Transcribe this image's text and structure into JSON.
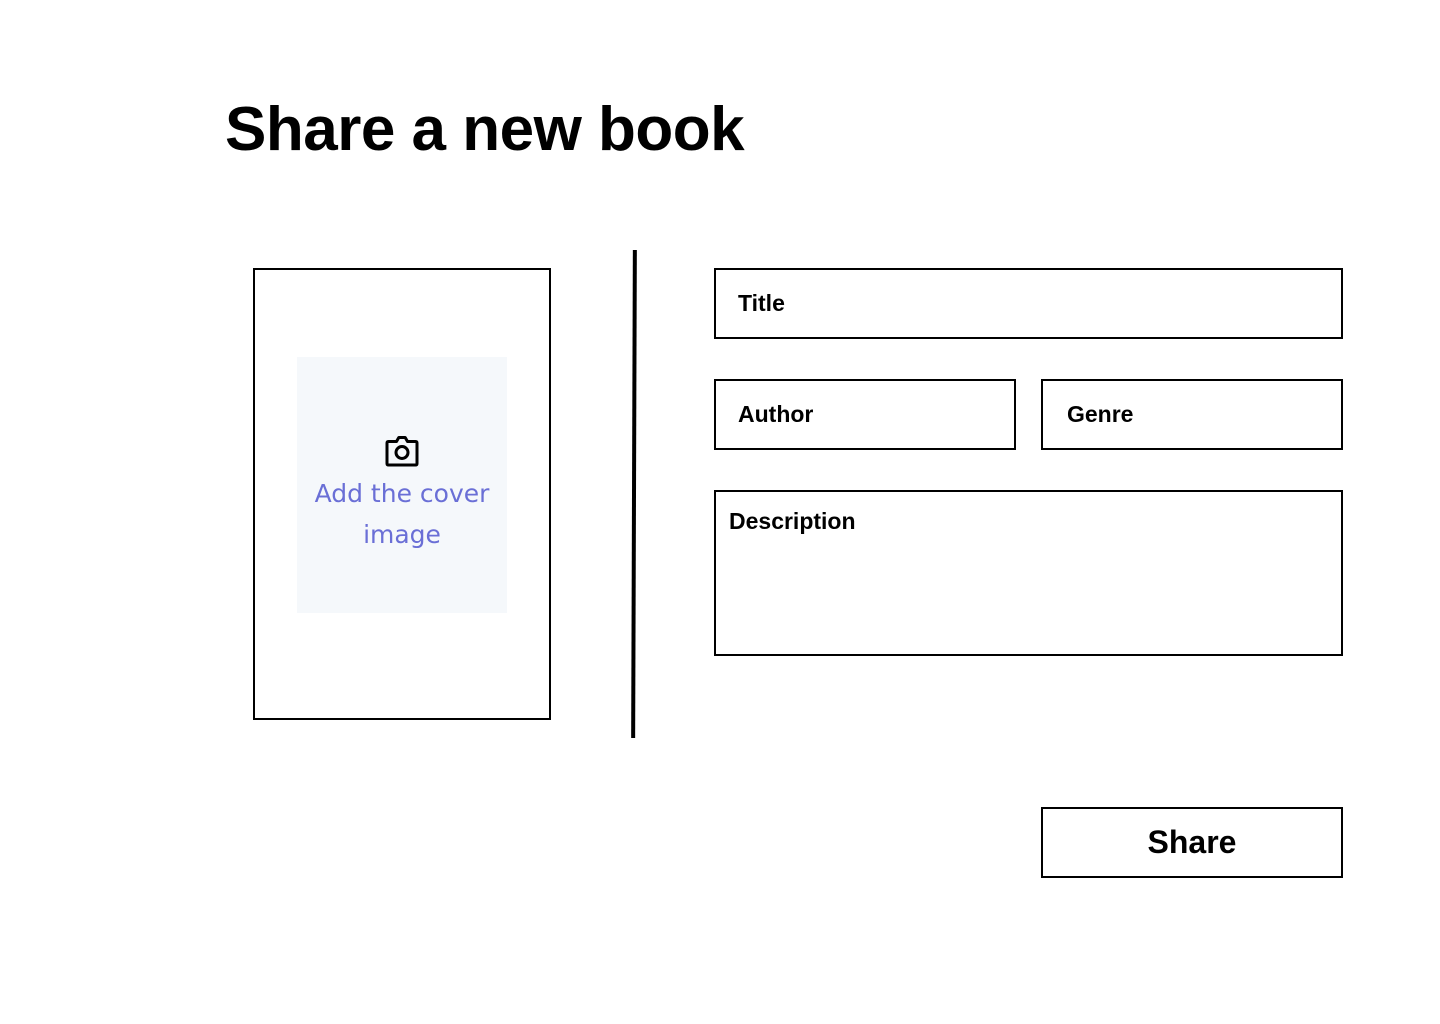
{
  "header": {
    "title": "Share a new book"
  },
  "cover": {
    "upload_label": "Add the cover image",
    "icon": "camera-icon",
    "label_color": "#6a6fd6",
    "background_color": "#f5f8fb"
  },
  "form": {
    "title_placeholder": "Title",
    "author_placeholder": "Author",
    "genre_placeholder": "Genre",
    "description_placeholder": "Description"
  },
  "actions": {
    "share_label": "Share"
  }
}
